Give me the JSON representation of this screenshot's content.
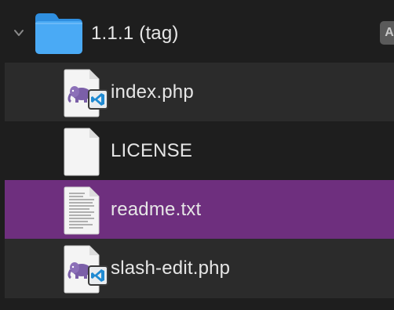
{
  "folder": {
    "name": "1.1.1 (tag)",
    "expanded": true,
    "corner_label": "A"
  },
  "files": [
    {
      "name": "index.php",
      "icon": "php-file-icon",
      "selected": false
    },
    {
      "name": "LICENSE",
      "icon": "generic-file-icon",
      "selected": false
    },
    {
      "name": "readme.txt",
      "icon": "text-file-icon",
      "selected": true
    },
    {
      "name": "slash-edit.php",
      "icon": "php-file-icon",
      "selected": false
    }
  ],
  "colors": {
    "background": "#1e1e1e",
    "row_alternate": "#2b2b2b",
    "selection": "#6e2f7e",
    "folder_blue": "#3aa0f0",
    "php_purple": "#7b5fa8",
    "vscode_blue": "#1f8ad2"
  }
}
